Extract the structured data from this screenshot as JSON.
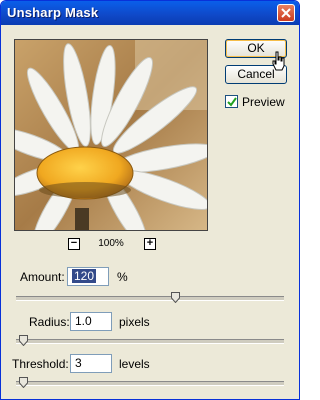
{
  "window": {
    "title": "Unsharp Mask"
  },
  "buttons": {
    "ok_label": "OK",
    "cancel_label": "Cancel"
  },
  "preview": {
    "label": "Preview",
    "checked": true
  },
  "zoom": {
    "minus": "−",
    "level": "100%",
    "plus": "+"
  },
  "amount": {
    "label": "Amount:",
    "value": "120",
    "unit": "%",
    "slider_fraction": 0.6
  },
  "radius": {
    "label": "Radius:",
    "value": "1.0",
    "unit": "pixels",
    "slider_fraction": 0.01
  },
  "threshold": {
    "label": "Threshold:",
    "value": "3",
    "unit": "levels",
    "slider_fraction": 0.01
  },
  "colors": {
    "titlebar": "#0f48c7",
    "dialog_bg": "#ece9d8",
    "selection": "#334a8a",
    "flower_center": "#f0a820"
  }
}
